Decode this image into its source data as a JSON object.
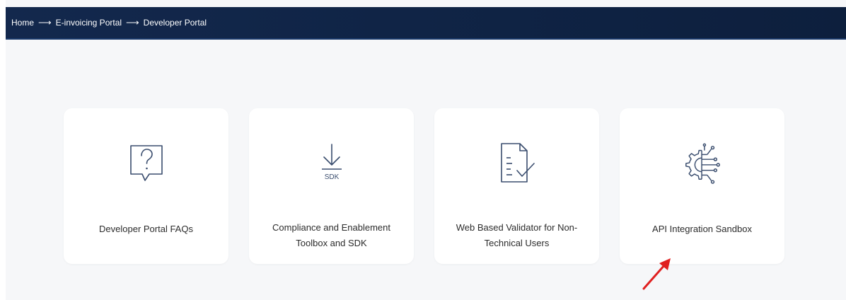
{
  "breadcrumb": {
    "items": [
      "Home",
      "E-invoicing Portal",
      "Developer Portal"
    ],
    "separator": "⟶"
  },
  "cards": [
    {
      "label": "Developer Portal FAQs",
      "icon": "question-mark-icon"
    },
    {
      "label": "Compliance and Enablement Toolbox and SDK",
      "icon": "sdk-download-icon",
      "icon_text": "SDK"
    },
    {
      "label": "Web Based Validator for Non-Technical Users",
      "icon": "document-check-icon"
    },
    {
      "label": "API Integration Sandbox",
      "icon": "gear-circuit-icon"
    }
  ],
  "colors": {
    "header_bg": "#13284d",
    "icon_stroke": "#3a4d6e",
    "annotation": "#e02020"
  }
}
